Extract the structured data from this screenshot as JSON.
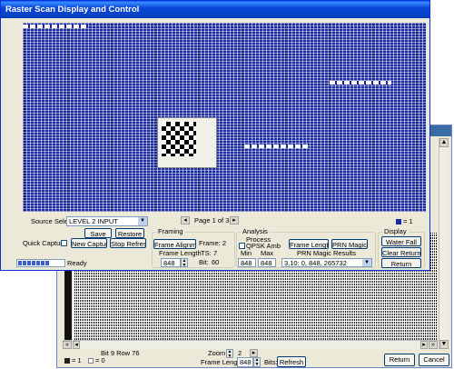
{
  "back_window": {
    "status_left": "Bit 9 Row 76",
    "zoom_label": "Zoom",
    "zoom_value": "2",
    "frame_length_label": "Frame Length",
    "frame_length_value": "848",
    "bits_label": "Bits:",
    "refresh_label": "Refresh",
    "legend_one": "= 1",
    "legend_zero": "= 0",
    "return_label": "Return",
    "cancel_label": "Cancel"
  },
  "main_window": {
    "title": "Raster Scan Display and Control",
    "legend_one": "= 1",
    "source_select_label": "Source Select",
    "source_select_value": "LEVEL 2 INPUT",
    "save_label": "Save",
    "restore_label": "Restore",
    "quick_capture_label": "Quick Capture",
    "new_capture_label": "New Capture",
    "stop_refresh_label": "Stop Refresh",
    "status_text": "Ready",
    "progress": 0.7,
    "page_text": "Page 1 of 3",
    "framing": {
      "title": "Framing",
      "frame_alignment_label": "Frame Alignment",
      "frame_label": "Frame: 2",
      "ts_label": "TS:",
      "ts_value": "7",
      "frame_length_label": "Frame Length",
      "frame_length_value": "848",
      "bit_label": "Bit:",
      "bit_value": "60"
    },
    "analysis": {
      "title": "Analysis",
      "process_label": "Process",
      "qpsk_label": "QPSK Amb",
      "min_label": "Min",
      "max_label": "Max",
      "min_value": "848",
      "max_value": "848",
      "frame_length_btn": "Frame Length",
      "prn_magic_btn": "PRN Magic",
      "prn_results_label": "PRN Magic Results",
      "prn_results_value": "3,10: 0, 848, 265732"
    },
    "display": {
      "title": "Display",
      "water_fall_label": "Water Fall",
      "clear_return_label": "Clear Return",
      "return_label": "Return"
    }
  },
  "colors": {
    "title_bar": "#0a246a",
    "raster_bg": "#1a2aa0",
    "progress": "#3d5fd0"
  }
}
